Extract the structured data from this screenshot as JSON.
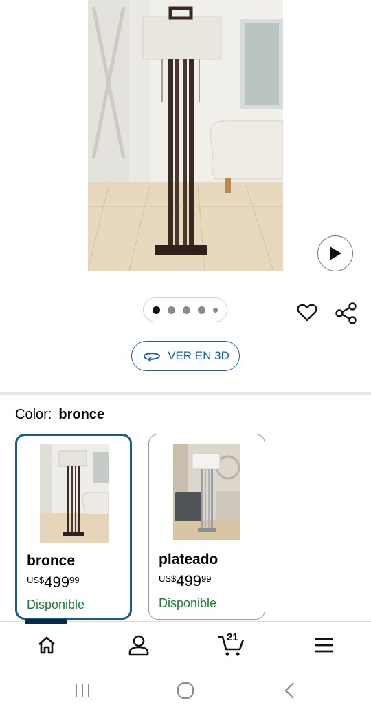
{
  "hero": {
    "image": "floor-lamp-bronze-living-room",
    "play_icon": "play-icon",
    "carousel_count": 5,
    "carousel_active": 0
  },
  "actions": {
    "favorite_icon": "heart-icon",
    "share_icon": "share-icon"
  },
  "view3d": {
    "label": "VER EN 3D",
    "icon": "rotate-3d-icon"
  },
  "color": {
    "label": "Color:",
    "value": "bronce"
  },
  "variants": [
    {
      "name": "bronce",
      "currency": "US$",
      "price_whole": "499",
      "price_cents": "99",
      "status": "Disponible",
      "selected": true
    },
    {
      "name": "plateado",
      "currency": "US$",
      "price_whole": "499",
      "price_cents": "99",
      "status": "Disponible",
      "selected": false
    }
  ],
  "nav": {
    "cart_count": "21",
    "items": [
      "home-icon",
      "account-icon",
      "cart-icon",
      "menu-icon"
    ]
  },
  "system": {
    "items": [
      "recents-icon",
      "home-circle-icon",
      "back-icon"
    ]
  },
  "colors": {
    "accent_blue": "#1a5fb4",
    "selected_border": "#1d5a8c",
    "available_green": "#1e7b34"
  }
}
